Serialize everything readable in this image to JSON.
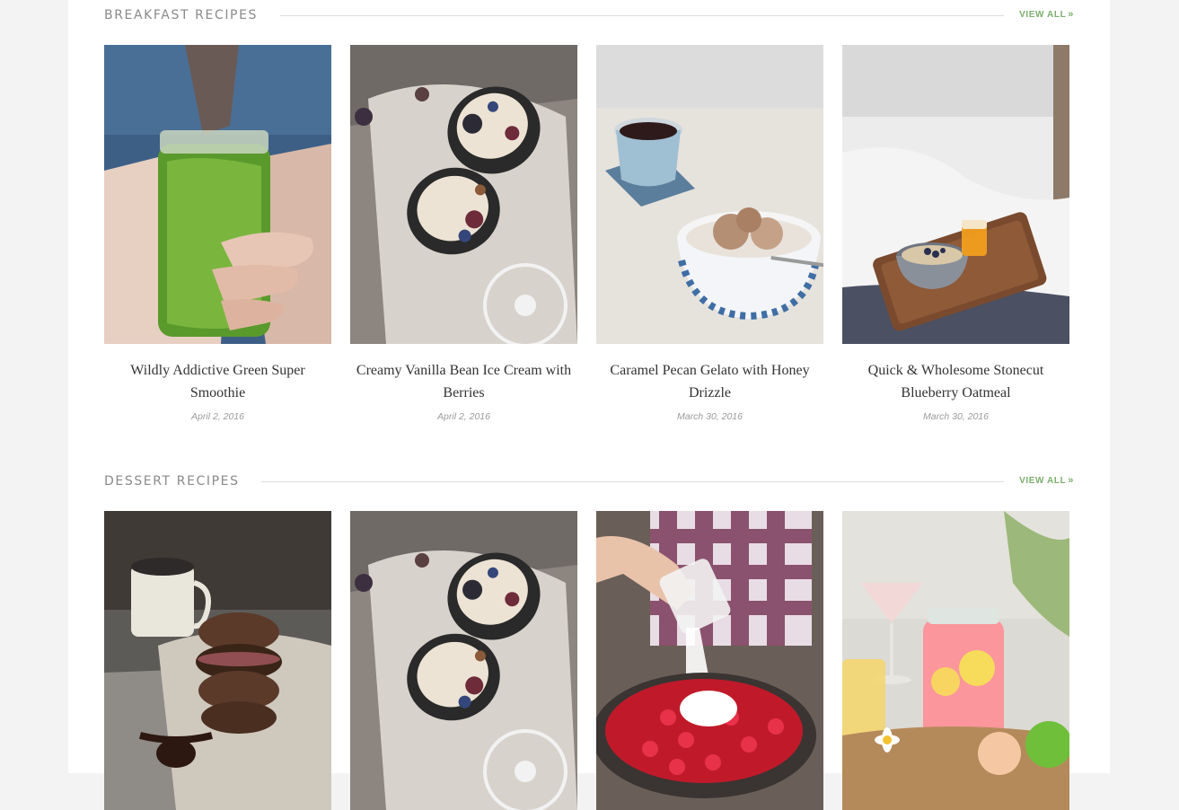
{
  "colors": {
    "page_background": "#f3f3f3",
    "content_background": "#ffffff",
    "section_title": "#8a8a8a",
    "view_all_accent": "#7cae6e",
    "date_text": "#9a9a9a"
  },
  "sections": [
    {
      "title": "BREAKFAST RECIPES",
      "view_all": "VIEW ALL",
      "view_all_icon": "double-chevron-right-icon",
      "cards": [
        {
          "title": "Wildly Addictive Green Super Smoothie",
          "date": "April 2, 2016",
          "image": "green-smoothie-jar-photo"
        },
        {
          "title": "Creamy Vanilla Bean Ice Cream with Berries",
          "date": "April 2, 2016",
          "image": "ice-cream-cones-berries-photo"
        },
        {
          "title": "Caramel Pecan Gelato with Honey Drizzle",
          "date": "March 30, 2016",
          "image": "gelato-bowl-coffee-cup-photo"
        },
        {
          "title": "Quick & Wholesome Stonecut Blueberry Oatmeal",
          "date": "March 30, 2016",
          "image": "oatmeal-breakfast-tray-photo"
        }
      ]
    },
    {
      "title": "DESSERT RECIPES",
      "view_all": "VIEW ALL",
      "view_all_icon": "double-chevron-right-icon",
      "cards": [
        {
          "image": "chocolate-cookie-sandwich-photo"
        },
        {
          "image": "ice-cream-cones-berries-photo"
        },
        {
          "image": "strawberries-sugar-pot-photo"
        },
        {
          "image": "pink-lemonade-drinks-photo"
        }
      ]
    }
  ]
}
